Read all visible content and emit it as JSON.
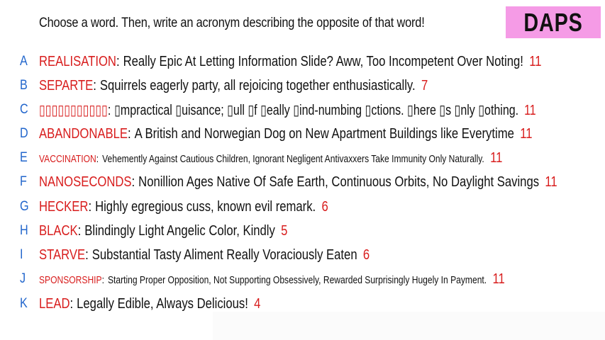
{
  "instruction": "Choose a word. Then, write an acronym describing the opposite of that word!",
  "logo": {
    "text": "DAPS",
    "color": "#f59be6"
  },
  "colors": {
    "letter": "#2266cc",
    "word": "#d81d1d",
    "text": "#111111"
  },
  "entries": [
    {
      "letter": "A",
      "word": "REALISATION",
      "acronym": "Really Epic At Letting Information Slide? Aww, Too Incompetent Over Noting!",
      "count": "11"
    },
    {
      "letter": "B",
      "word": "SEPARTE",
      "acronym": "Squirrels eagerly party, all rejoicing together enthusiastically.",
      "count": "7"
    },
    {
      "letter": "C",
      "word": "▯▯▯▯▯▯▯▯▯▯▯",
      "acronym": "▯mpractical ▯uisance; ▯ull ▯f ▯eally ▯ind-numbing ▯ctions. ▯here ▯s ▯nly ▯othing.",
      "count": "11"
    },
    {
      "letter": "D",
      "word": "ABANDONABLE",
      "acronym": "A British and Norwegian Dog on New Apartment Buildings like Everytime",
      "count": "11"
    },
    {
      "letter": "E",
      "word": "VACCINATION",
      "acronym": "Vehemently Against Cautious Children, Ignorant Negligent Antivaxxers Take Immunity Only Naturally.",
      "count": "11"
    },
    {
      "letter": "F",
      "word": "NANOSECONDS",
      "acronym": "Nonillion Ages Native Of Safe Earth, Continuous Orbits, No Daylight Savings",
      "count": "11"
    },
    {
      "letter": "G",
      "word": "HECKER",
      "acronym": "Highly egregious cuss, known evil remark.",
      "count": "6"
    },
    {
      "letter": "H",
      "word": "BLACK",
      "acronym": "Blindingly Light Angelic Color, Kindly",
      "count": "5"
    },
    {
      "letter": "I",
      "word": "STARVE",
      "acronym": "Substantial Tasty Aliment Really Voraciously Eaten",
      "count": "6"
    },
    {
      "letter": "J",
      "word": "SPONSORSHIP",
      "acronym": "Starting Proper Opposition, Not Supporting Obsessively, Rewarded Surprisingly Hugely In Payment.",
      "count": "11"
    },
    {
      "letter": "K",
      "word": "LEAD",
      "acronym": "Legally Edible, Always Delicious!",
      "count": "4"
    }
  ]
}
